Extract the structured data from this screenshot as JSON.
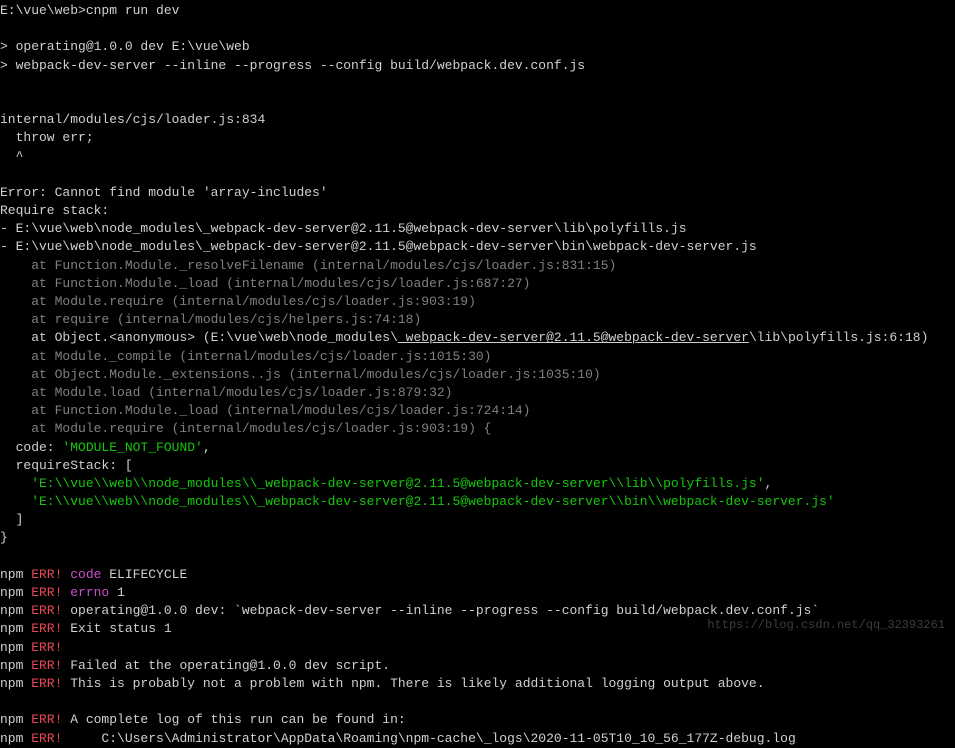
{
  "terminal": {
    "prompt": "E:\\vue\\web>cnpm run dev",
    "script1": "> operating@1.0.0 dev E:\\vue\\web",
    "script2": "> webpack-dev-server --inline --progress --config build/webpack.dev.conf.js",
    "loader1": "internal/modules/cjs/loader.js:834",
    "loader2": "  throw err;",
    "loader3": "  ^",
    "errorLine": "Error: Cannot find module 'array-includes'",
    "requireStack": "Require stack:",
    "stack1": "- E:\\vue\\web\\node_modules\\_webpack-dev-server@2.11.5@webpack-dev-server\\lib\\polyfills.js",
    "stack2": "- E:\\vue\\web\\node_modules\\_webpack-dev-server@2.11.5@webpack-dev-server\\bin\\webpack-dev-server.js",
    "at1": "    at Function.Module._resolveFilename (internal/modules/cjs/loader.js:831:15)",
    "at2": "    at Function.Module._load (internal/modules/cjs/loader.js:687:27)",
    "at3": "    at Module.require (internal/modules/cjs/loader.js:903:19)",
    "at4": "    at require (internal/modules/cjs/helpers.js:74:18)",
    "at5a": "    at Object.<anonymous> (E:\\vue\\web\\node_modules\\",
    "at5b": "_webpack-dev-server@2.11.5@webpack-dev-server",
    "at5c": "\\lib\\polyfills.js:6:18)",
    "at6": "    at Module._compile (internal/modules/cjs/loader.js:1015:30)",
    "at7": "    at Object.Module._extensions..js (internal/modules/cjs/loader.js:1035:10)",
    "at8": "    at Module.load (internal/modules/cjs/loader.js:879:32)",
    "at9": "    at Function.Module._load (internal/modules/cjs/loader.js:724:14)",
    "at10": "    at Module.require (internal/modules/cjs/loader.js:903:19) {",
    "codeLabel": "  code: ",
    "codeVal": "'MODULE_NOT_FOUND'",
    "comma": ",",
    "reqStackOpen": "  requireStack: [",
    "req1": "    'E:\\\\vue\\\\web\\\\node_modules\\\\_webpack-dev-server@2.11.5@webpack-dev-server\\\\lib\\\\polyfills.js'",
    "req2": "    'E:\\\\vue\\\\web\\\\node_modules\\\\_webpack-dev-server@2.11.5@webpack-dev-server\\\\bin\\\\webpack-dev-server.js'",
    "reqClose": "  ]",
    "brace": "}",
    "npmLabel": "npm",
    "errLabel": " ERR!",
    "errCode": " code",
    "elife": " ELIFECYCLE",
    "errErrno": " errno",
    "one": " 1",
    "errMsg1": " operating@1.0.0 dev: `webpack-dev-server --inline --progress --config build/webpack.dev.conf.js`",
    "errMsg2": " Exit status 1",
    "errMsg3": " Failed at the operating@1.0.0 dev script.",
    "errMsg4": " This is probably not a problem with npm. There is likely additional logging output above.",
    "errMsg5": " A complete log of this run can be found in:",
    "errMsg6": "     C:\\Users\\Administrator\\AppData\\Roaming\\npm-cache\\_logs\\2020-11-05T10_10_56_177Z-debug.log",
    "watermark": "https://blog.csdn.net/qq_32393261"
  }
}
